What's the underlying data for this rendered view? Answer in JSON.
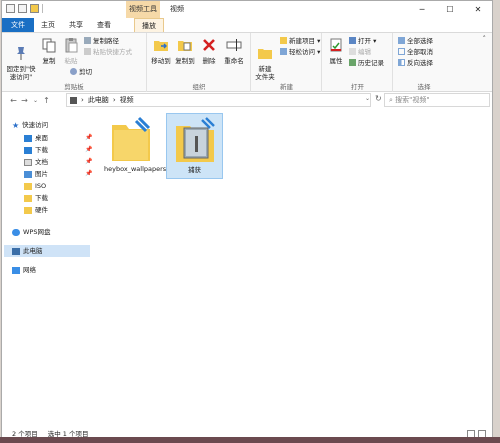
{
  "title": {
    "context_tab": "视频工具",
    "window_title": "视频"
  },
  "tabs": [
    "文件",
    "主页",
    "共享",
    "查看",
    "播放"
  ],
  "ribbon": {
    "pin_label": "固定到\"快\n速访问\"",
    "copy_label": "复制",
    "paste_label": "粘贴",
    "copy_path": "复制路径",
    "paste_shortcut": "粘贴快捷方式",
    "cut": "剪切",
    "group_clipboard": "剪贴板",
    "move_to": "移动到",
    "copy_to": "复制到",
    "delete": "删除",
    "rename": "重命名",
    "group_organize": "组织",
    "new_folder": "新建\n文件夹",
    "new_item": "新建项目",
    "easy_access": "轻松访问",
    "group_new": "新建",
    "properties": "属性",
    "open": "打开",
    "edit": "编辑",
    "history": "历史记录",
    "group_open": "打开",
    "select_all": "全部选择",
    "select_none": "全部取消",
    "invert": "反向选择",
    "group_select": "选择"
  },
  "address": {
    "crumbs": [
      "此电脑",
      "视频"
    ],
    "search_placeholder": "搜索\"视频\""
  },
  "nav": {
    "quick_access": "快速访问",
    "items": [
      "桌面",
      "下载",
      "文档",
      "图片",
      "ISO",
      "下载",
      "硬件"
    ],
    "wps": "WPS网盘",
    "this_pc": "此电脑",
    "network": "网络"
  },
  "files": [
    {
      "name": "heybox_wallpapers"
    },
    {
      "name": "捕获"
    }
  ],
  "status": {
    "count": "2 个项目",
    "selected": "选中 1 个项目"
  },
  "colors": {
    "folder": "#f3c94b",
    "accent": "#1a6fc4",
    "selection": "#cde4f7"
  }
}
